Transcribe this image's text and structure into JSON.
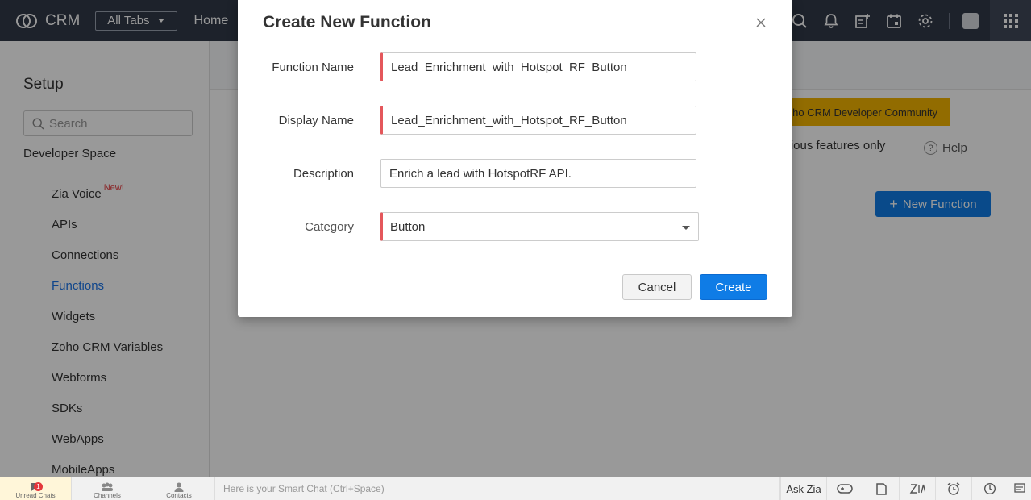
{
  "topbar": {
    "brand": "CRM",
    "all_tabs": "All Tabs",
    "home": "Home"
  },
  "sidebar": {
    "title": "Setup",
    "search_placeholder": "Search",
    "section": "Developer Space",
    "items": [
      {
        "label": "Zia Voice",
        "badge": "New!"
      },
      {
        "label": "APIs"
      },
      {
        "label": "Connections"
      },
      {
        "label": "Functions",
        "active": true
      },
      {
        "label": "Widgets"
      },
      {
        "label": "Zoho CRM Variables"
      },
      {
        "label": "Webforms"
      },
      {
        "label": "SDKs"
      },
      {
        "label": "WebApps"
      },
      {
        "label": "MobileApps"
      }
    ]
  },
  "main": {
    "community_button": "oho CRM Developer Community",
    "description_fragment": "various features only",
    "help": "Help",
    "new_function_button": "New Function"
  },
  "modal": {
    "title": "Create New Function",
    "fields": {
      "function_name": {
        "label": "Function Name",
        "value": "Lead_Enrichment_with_Hotspot_RF_Button"
      },
      "display_name": {
        "label": "Display Name",
        "value": "Lead_Enrichment_with_Hotspot_RF_Button"
      },
      "description": {
        "label": "Description",
        "value": "Enrich a lead with HotspotRF API."
      },
      "category": {
        "label": "Category",
        "value": "Button"
      }
    },
    "cancel": "Cancel",
    "create": "Create"
  },
  "bottombar": {
    "unread_chats": "Unread Chats",
    "unread_count": "1",
    "channels": "Channels",
    "contacts": "Contacts",
    "smart_chat_placeholder": "Here is your Smart Chat (Ctrl+Space)",
    "ask_zia": "Ask Zia"
  },
  "colors": {
    "topbar": "#313949",
    "primary": "#0f7ce6",
    "required": "#e4575b",
    "community": "#f4b400"
  }
}
